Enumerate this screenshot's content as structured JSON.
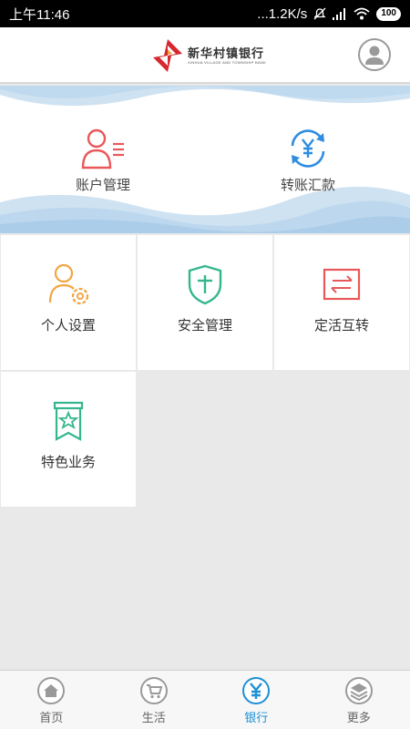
{
  "status_bar": {
    "time": "上午11:46",
    "network_speed": "...1.2K/s",
    "battery": "100"
  },
  "header": {
    "logo_title": "新华村镇银行",
    "logo_subtitle": "XINHUA VILLAGE AND TOWNSHIP BANK",
    "logo_colors": [
      "#d7282f",
      "#f2a03d"
    ]
  },
  "banner": {
    "items": [
      {
        "label": "账户管理",
        "icon": "account-card-icon",
        "color": "#e8585a"
      },
      {
        "label": "转账汇款",
        "icon": "yuan-transfer-icon",
        "color": "#2f8de0"
      }
    ]
  },
  "grid": {
    "items": [
      {
        "label": "个人设置",
        "icon": "user-settings-icon",
        "color": "#f2a541"
      },
      {
        "label": "安全管理",
        "icon": "shield-icon",
        "color": "#35b68e"
      },
      {
        "label": "定活互转",
        "icon": "swap-icon",
        "color": "#e8585a"
      },
      {
        "label": "特色业务",
        "icon": "ribbon-star-icon",
        "color": "#35b68e"
      }
    ]
  },
  "tabbar": {
    "active_color": "#1e90d6",
    "items": [
      {
        "label": "首页",
        "icon": "home-icon"
      },
      {
        "label": "生活",
        "icon": "cart-icon"
      },
      {
        "label": "银行",
        "icon": "yuan-icon",
        "active": true
      },
      {
        "label": "更多",
        "icon": "layers-icon"
      }
    ]
  }
}
